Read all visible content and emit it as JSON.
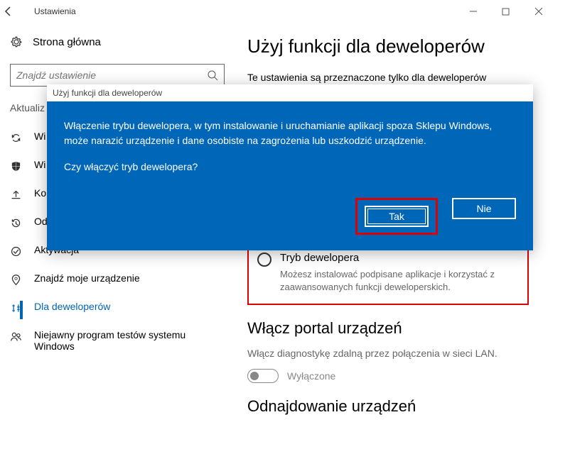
{
  "window": {
    "title": "Ustawienia"
  },
  "sidebar": {
    "home": "Strona główna",
    "search_placeholder": "Znajdź ustawienie",
    "group": "Aktualiz",
    "items": [
      {
        "label": "Wi"
      },
      {
        "label": "Wi"
      },
      {
        "label": "Ko"
      },
      {
        "label": "Odzyskiwanie"
      },
      {
        "label": "Aktywacja"
      },
      {
        "label": "Znajdź moje urządzenie"
      },
      {
        "label": "Dla deweloperów"
      },
      {
        "label": "Niejawny program testów systemu Windows"
      }
    ]
  },
  "content": {
    "h1": "Użyj funkcji dla deweloperów",
    "intro": "Te ustawienia są przeznaczone tylko dla deweloperów",
    "dev_option": {
      "title": "Tryb dewelopera",
      "desc": "Możesz instalować podpisane aplikacje i korzystać z zaawansowanych funkcji deweloperskich."
    },
    "portal_h": "Włącz portal urządzeń",
    "portal_sub": "Włącz diagnostykę zdalną przez połączenia w sieci LAN.",
    "toggle_off": "Wyłączone",
    "discover_h": "Odnajdowanie urządzeń"
  },
  "dialog": {
    "title": "Użyj funkcji dla deweloperów",
    "message": "Włączenie trybu dewelopera, w tym instalowanie i uruchamianie aplikacji spoza Sklepu Windows, może narazić urządzenie i dane osobiste na zagrożenia lub uszkodzić urządzenie.",
    "question": "Czy włączyć tryb dewelopera?",
    "yes": "Tak",
    "no": "Nie"
  }
}
